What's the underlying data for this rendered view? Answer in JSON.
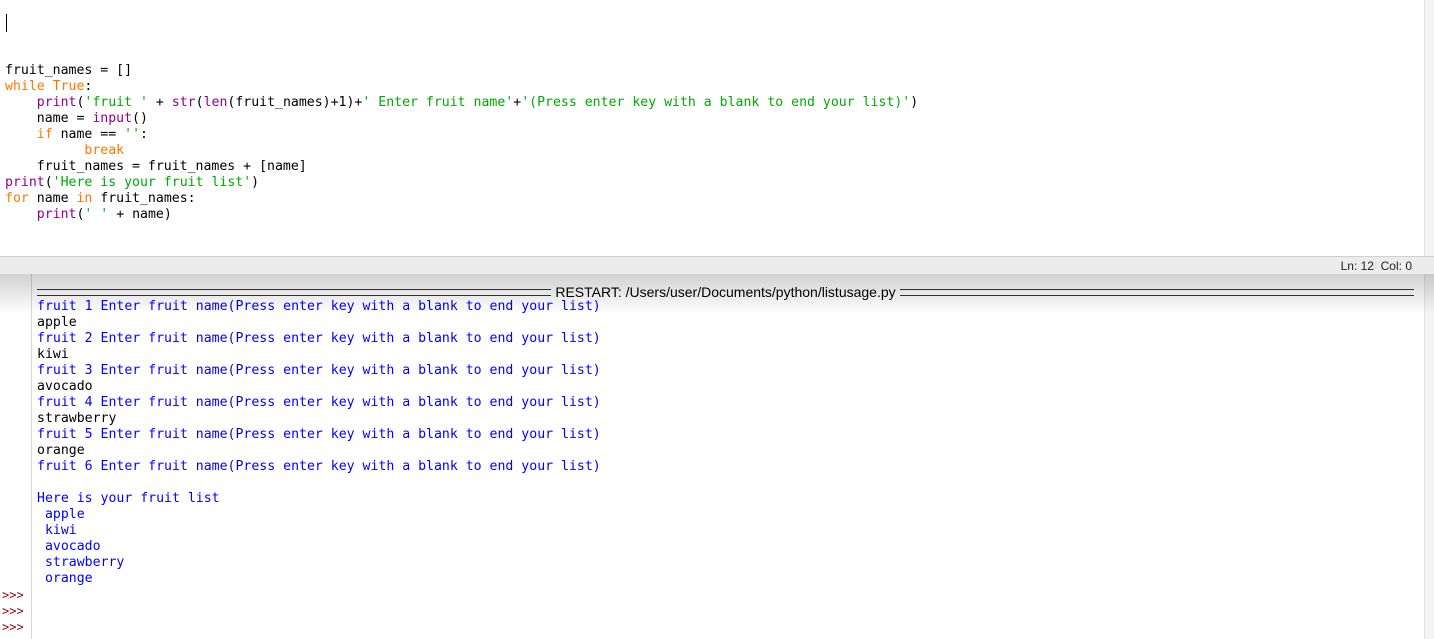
{
  "editor": {
    "lines": [
      [
        {
          "t": "fruit_names = []",
          "c": ""
        }
      ],
      [
        {
          "t": "while",
          "c": "kw"
        },
        {
          "t": " ",
          "c": ""
        },
        {
          "t": "True",
          "c": "kw"
        },
        {
          "t": ":",
          "c": ""
        }
      ],
      [
        {
          "t": "    ",
          "c": ""
        },
        {
          "t": "print",
          "c": "bi"
        },
        {
          "t": "(",
          "c": ""
        },
        {
          "t": "'fruit '",
          "c": "str"
        },
        {
          "t": " + ",
          "c": ""
        },
        {
          "t": "str",
          "c": "bi"
        },
        {
          "t": "(",
          "c": ""
        },
        {
          "t": "len",
          "c": "bi"
        },
        {
          "t": "(fruit_names)+1)+",
          "c": ""
        },
        {
          "t": "' Enter fruit name'",
          "c": "str"
        },
        {
          "t": "+",
          "c": ""
        },
        {
          "t": "'(Press enter key with a blank to end your list)'",
          "c": "str"
        },
        {
          "t": ")",
          "c": ""
        }
      ],
      [
        {
          "t": "    name = ",
          "c": ""
        },
        {
          "t": "input",
          "c": "bi"
        },
        {
          "t": "()",
          "c": ""
        }
      ],
      [
        {
          "t": "    ",
          "c": ""
        },
        {
          "t": "if",
          "c": "kw"
        },
        {
          "t": " name == ",
          "c": ""
        },
        {
          "t": "''",
          "c": "str"
        },
        {
          "t": ":",
          "c": ""
        }
      ],
      [
        {
          "t": "          ",
          "c": ""
        },
        {
          "t": "break",
          "c": "kw"
        }
      ],
      [
        {
          "t": "    fruit_names = fruit_names + [name]",
          "c": ""
        }
      ],
      [
        {
          "t": "print",
          "c": "bi"
        },
        {
          "t": "(",
          "c": ""
        },
        {
          "t": "'Here is your fruit list'",
          "c": "str"
        },
        {
          "t": ")",
          "c": ""
        }
      ],
      [
        {
          "t": "for",
          "c": "kw"
        },
        {
          "t": " name ",
          "c": ""
        },
        {
          "t": "in",
          "c": "kw"
        },
        {
          "t": " fruit_names:",
          "c": ""
        }
      ],
      [
        {
          "t": "    ",
          "c": ""
        },
        {
          "t": "print",
          "c": "bi"
        },
        {
          "t": "(",
          "c": ""
        },
        {
          "t": "' '",
          "c": "str"
        },
        {
          "t": " + name)",
          "c": ""
        }
      ]
    ]
  },
  "status": {
    "text": "Ln: 12  Col: 0"
  },
  "shell": {
    "restart_label": "RESTART: /Users/user/Documents/python/listusage.py",
    "lines": [
      {
        "t": "fruit 1 Enter fruit name(Press enter key with a blank to end your list)",
        "c": "so"
      },
      {
        "t": "apple",
        "c": "si"
      },
      {
        "t": "fruit 2 Enter fruit name(Press enter key with a blank to end your list)",
        "c": "so"
      },
      {
        "t": "kiwi",
        "c": "si"
      },
      {
        "t": "fruit 3 Enter fruit name(Press enter key with a blank to end your list)",
        "c": "so"
      },
      {
        "t": "avocado",
        "c": "si"
      },
      {
        "t": "fruit 4 Enter fruit name(Press enter key with a blank to end your list)",
        "c": "so"
      },
      {
        "t": "strawberry",
        "c": "si"
      },
      {
        "t": "fruit 5 Enter fruit name(Press enter key with a blank to end your list)",
        "c": "so"
      },
      {
        "t": "orange",
        "c": "si"
      },
      {
        "t": "fruit 6 Enter fruit name(Press enter key with a blank to end your list)",
        "c": "so"
      },
      {
        "t": "",
        "c": "si"
      },
      {
        "t": "Here is your fruit list",
        "c": "so"
      },
      {
        "t": " apple",
        "c": "so"
      },
      {
        "t": " kiwi",
        "c": "so"
      },
      {
        "t": " avocado",
        "c": "so"
      },
      {
        "t": " strawberry",
        "c": "so"
      },
      {
        "t": " orange",
        "c": "so"
      }
    ],
    "prompts": [
      ">>>",
      ">>>",
      ">>>"
    ]
  },
  "colors": {
    "keyword": "#ff7700",
    "builtin": "#900090",
    "string": "#00aa00",
    "stdout": "#0000ff",
    "prompt": "#990000"
  }
}
